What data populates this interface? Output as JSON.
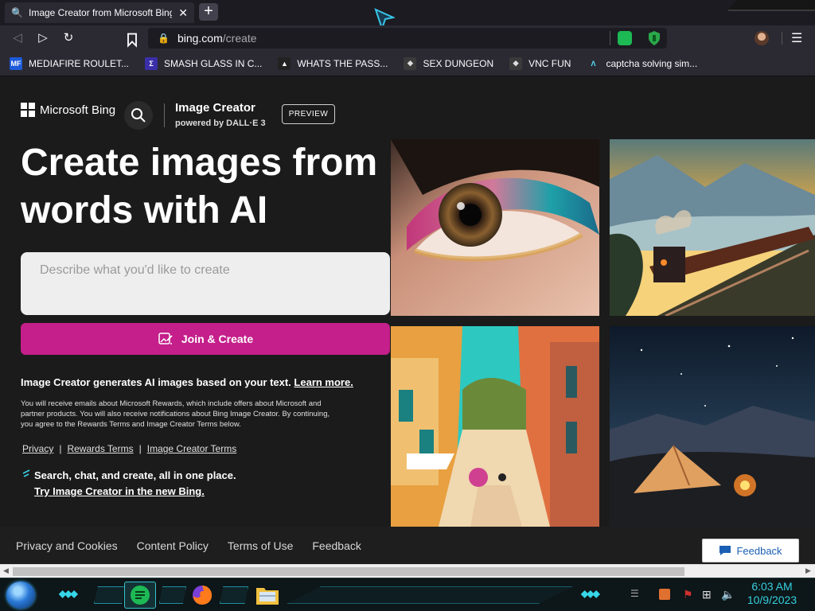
{
  "browser": {
    "tab_title": "Image Creator from Microsoft Bing",
    "tab_close": "✕",
    "new_tab": "+",
    "url_host": "bing.com",
    "url_path": "/create",
    "menu": "☰"
  },
  "bookmarks": [
    {
      "label": "MEDIAFIRE ROULET...",
      "icon": "MF",
      "icon_bg": "#1d5ad8",
      "icon_fg": "#ffffff"
    },
    {
      "label": "SMASH GLASS IN C...",
      "icon": "Σ",
      "icon_bg": "#3a2fa8",
      "icon_fg": "#ffffff"
    },
    {
      "label": "WHATS THE PASS...",
      "icon": "▲",
      "icon_bg": "#222222",
      "icon_fg": "#ffffff"
    },
    {
      "label": "SEX DUNGEON",
      "icon": "◆",
      "icon_bg": "#3a3a3a",
      "icon_fg": "#dddddd"
    },
    {
      "label": "VNC FUN",
      "icon": "◆",
      "icon_bg": "#3a3a3a",
      "icon_fg": "#dddddd"
    },
    {
      "label": "captcha solving sim...",
      "icon": "Λ",
      "icon_bg": "#2b2a33",
      "icon_fg": "#54e1ff"
    }
  ],
  "header": {
    "brand": "Microsoft Bing",
    "product": "Image Creator",
    "powered_by": "powered by DALL·E 3",
    "badge": "PREVIEW"
  },
  "hero": {
    "title": "Create images from words with AI",
    "prompt_placeholder": "Describe what you'd like to create",
    "create_button": "Join & Create"
  },
  "info": {
    "text": "Image Creator generates AI images based on your text. ",
    "learn_more": "Learn more.",
    "fine_print": "You will receive emails about Microsoft Rewards, which include offers about Microsoft and partner products. You will also receive notifications about Bing Image Creator. By continuing, you agree to the Rewards Terms and Image Creator Terms below."
  },
  "legal_links": [
    "Privacy",
    "Rewards Terms",
    "Image Creator Terms"
  ],
  "legal_separator": "|",
  "promo": {
    "text": "Search, chat, and create, all in one place.",
    "link": "Try Image Creator in the new Bing."
  },
  "footer": {
    "links": [
      "Privacy and Cookies",
      "Content Policy",
      "Terms of Use",
      "Feedback"
    ],
    "feedback_button": "Feedback"
  },
  "taskbar": {
    "time": "6:03 AM",
    "date": "10/9/2023"
  },
  "colors": {
    "accent": "#c41f8a",
    "clock": "#34d0e0"
  }
}
